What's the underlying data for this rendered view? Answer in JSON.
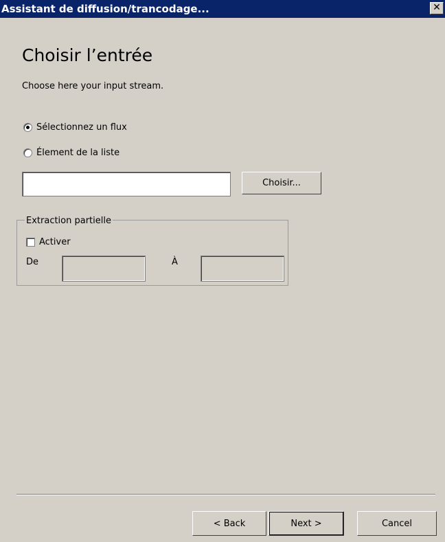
{
  "window": {
    "title": "Assistant de diffusion/trancodage...",
    "close_glyph": "✕"
  },
  "page": {
    "heading": "Choisir l’entrée",
    "description": "Choose here your input stream."
  },
  "source_options": [
    {
      "label": "Sélectionnez un flux",
      "checked": true
    },
    {
      "label": "Élement de la liste",
      "checked": false
    }
  ],
  "input": {
    "value": "",
    "choose_label": "Choisir..."
  },
  "partial_extraction": {
    "legend": "Extraction partielle",
    "enable_label": "Activer",
    "from_label": "De",
    "to_label": "À",
    "from_value": "",
    "to_value": ""
  },
  "footer": {
    "back_label": "< Back",
    "next_label": "Next >",
    "cancel_label": "Cancel"
  }
}
